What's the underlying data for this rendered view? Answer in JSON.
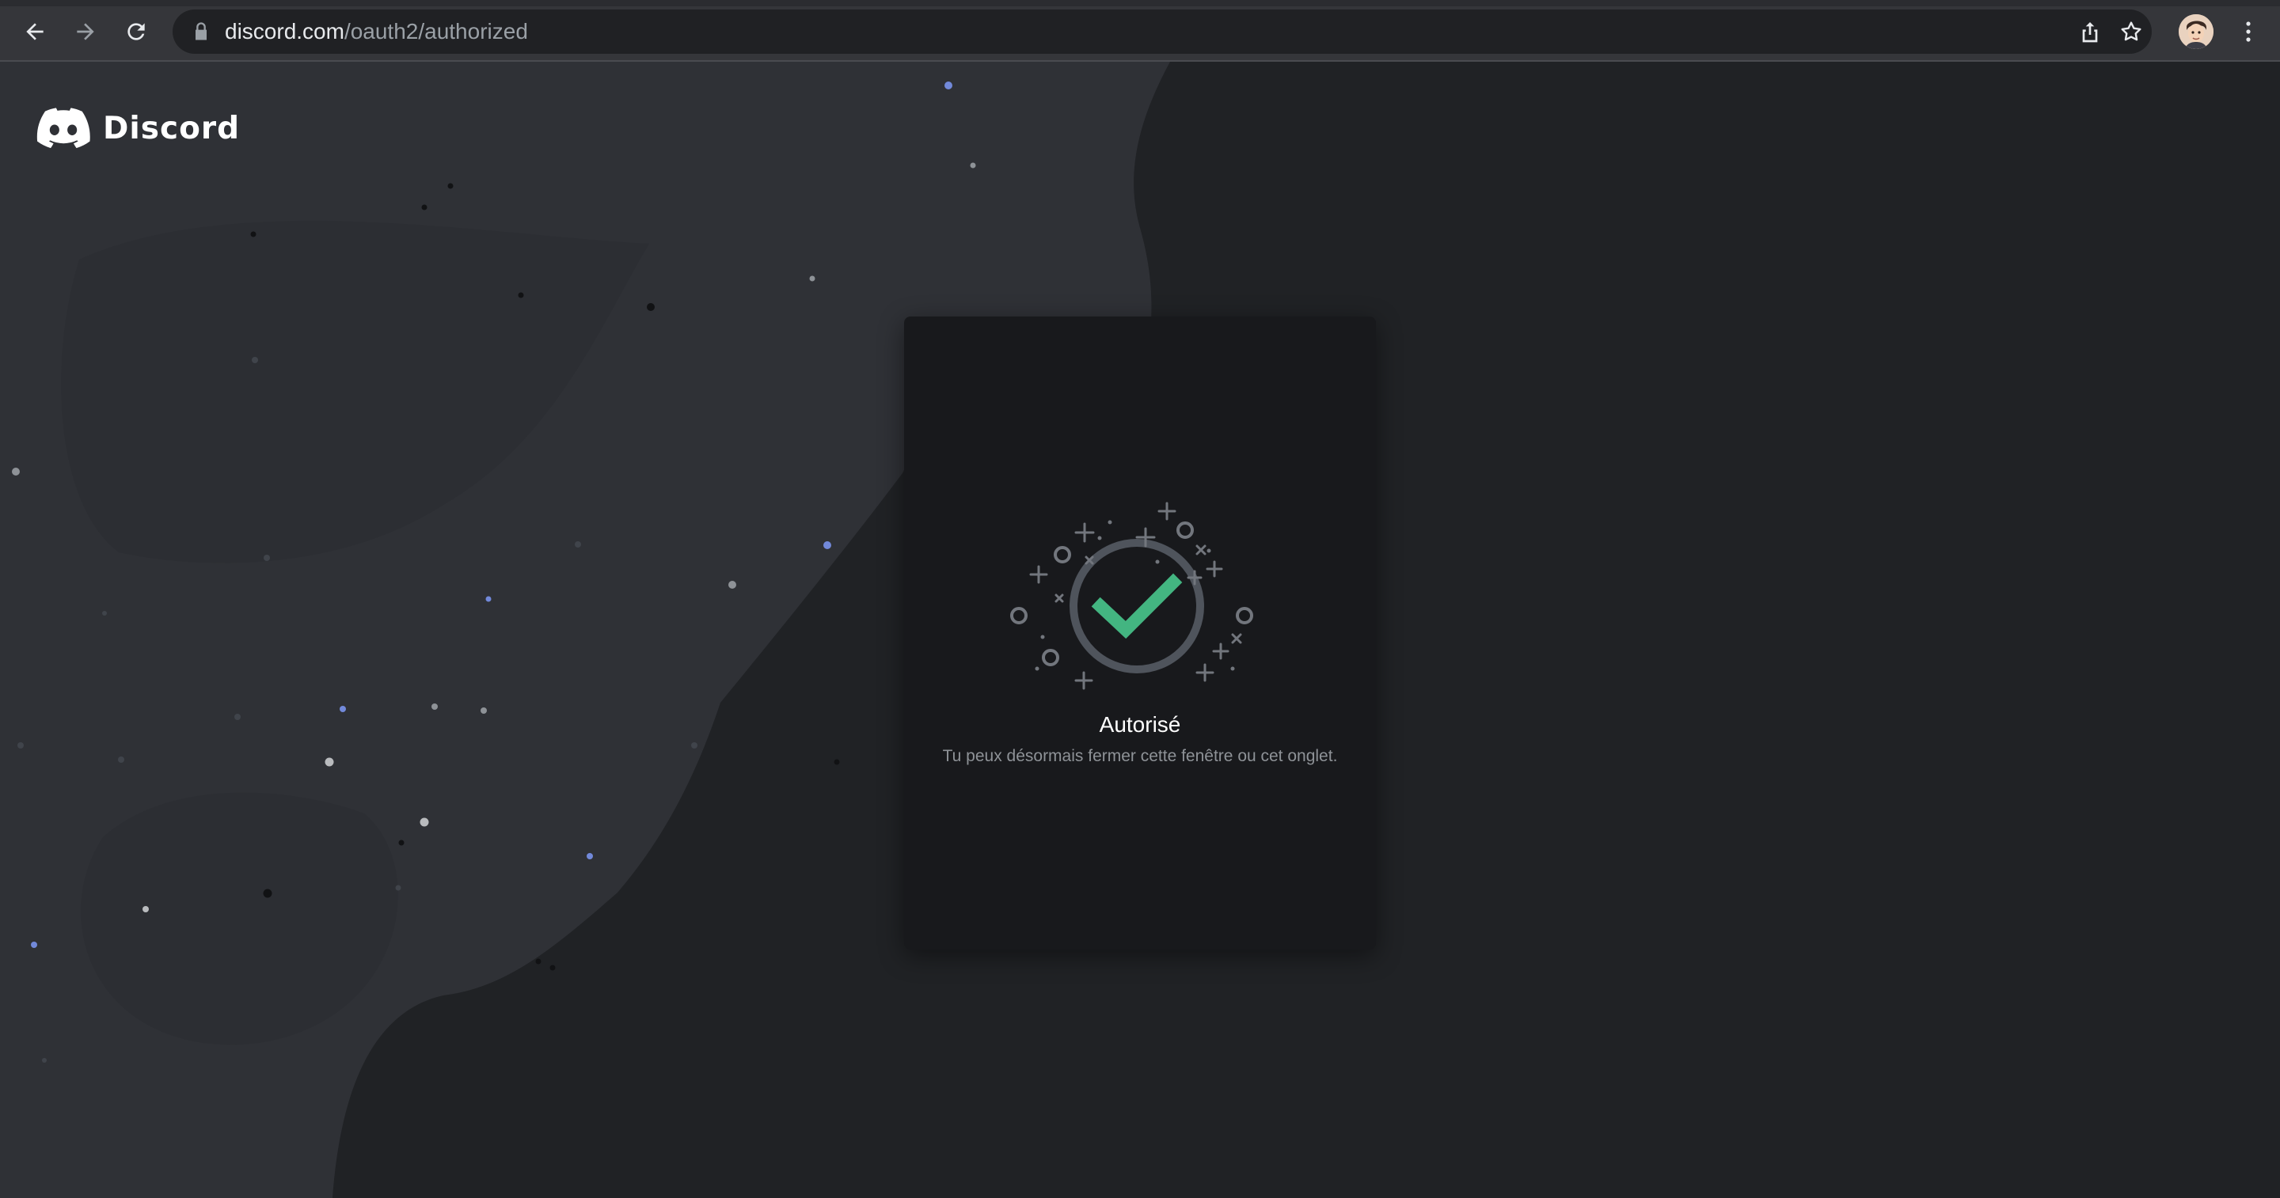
{
  "browser": {
    "url_domain": "discord.com",
    "url_path": "/oauth2/authorized",
    "icons": {
      "back": "arrow-left-icon",
      "forward": "arrow-right-icon",
      "reload": "reload-icon",
      "lock": "lock-icon",
      "share": "share-icon",
      "bookmark": "star-icon",
      "menu": "kebab-menu-icon"
    }
  },
  "header": {
    "brand_name": "Discord"
  },
  "card": {
    "title": "Autorisé",
    "subtitle": "Tu peux désormais fermer cette fenêtre ou cet onglet."
  },
  "colors": {
    "page_background": "#202225",
    "card_background": "#18191c",
    "success_green": "#43b581",
    "ring_gray": "#4f545c"
  }
}
